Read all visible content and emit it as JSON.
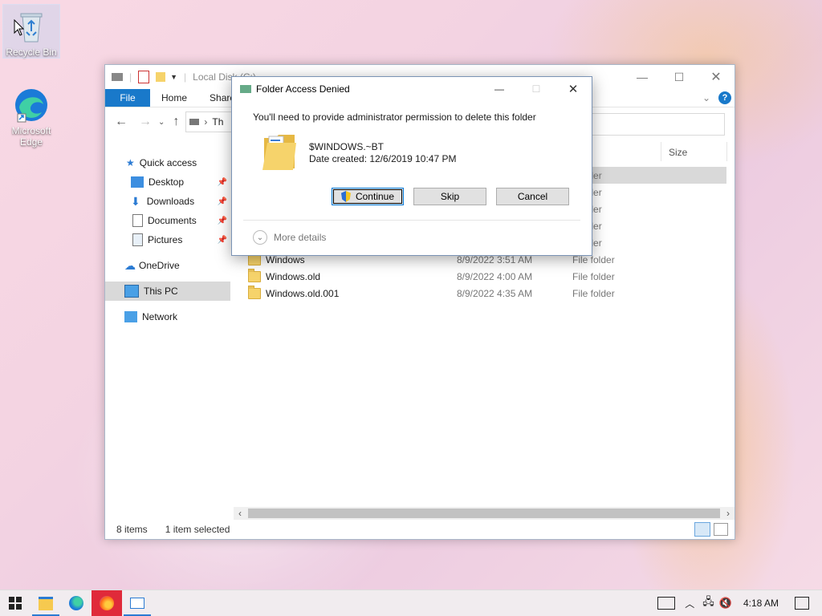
{
  "desktop": {
    "icons": [
      {
        "label": "Recycle Bin"
      },
      {
        "label": "Microsoft Edge"
      }
    ]
  },
  "explorer": {
    "title": "Local Disk (C:)",
    "ribbon_tabs": [
      "File",
      "Home",
      "Share"
    ],
    "address": "Th",
    "column_size": "Size",
    "nav": [
      {
        "label": "Quick access",
        "icon": "star-icon"
      },
      {
        "label": "Desktop",
        "icon": "desktop-icon",
        "pinned": true
      },
      {
        "label": "Downloads",
        "icon": "download-arrow-icon",
        "pinned": true
      },
      {
        "label": "Documents",
        "icon": "document-icon",
        "pinned": true
      },
      {
        "label": "Pictures",
        "icon": "picture-icon",
        "pinned": true
      },
      {
        "label": "OneDrive",
        "icon": "cloud-icon"
      },
      {
        "label": "This PC",
        "icon": "computer-icon"
      },
      {
        "label": "Network",
        "icon": "network-icon"
      }
    ],
    "rows": [
      {
        "name": "",
        "date": "",
        "type": "folder"
      },
      {
        "name": "",
        "date": "",
        "type": "folder"
      },
      {
        "name": "",
        "date": "",
        "type": "folder"
      },
      {
        "name": "",
        "date": "",
        "type": "folder"
      },
      {
        "name": "",
        "date": "",
        "type": "folder"
      },
      {
        "name": "Windows",
        "date": "8/9/2022 3:51 AM",
        "type": "File folder"
      },
      {
        "name": "Windows.old",
        "date": "8/9/2022 4:00 AM",
        "type": "File folder"
      },
      {
        "name": "Windows.old.001",
        "date": "8/9/2022 4:35 AM",
        "type": "File folder"
      }
    ],
    "status_items": "8 items",
    "status_selected": "1 item selected"
  },
  "dialog": {
    "title": "Folder Access Denied",
    "message": "You'll need to provide administrator permission to delete this folder",
    "folder_name": "$WINDOWS.~BT",
    "date_created": "Date created: 12/6/2019 10:47 PM",
    "continue_label": "Continue",
    "skip_label": "Skip",
    "cancel_label": "Cancel",
    "more_details": "More details"
  },
  "taskbar": {
    "time": "4:18 AM"
  },
  "colors": {
    "accent": "#1979ca",
    "selection": "#d9d9d9",
    "folder": "#f6d36b"
  }
}
